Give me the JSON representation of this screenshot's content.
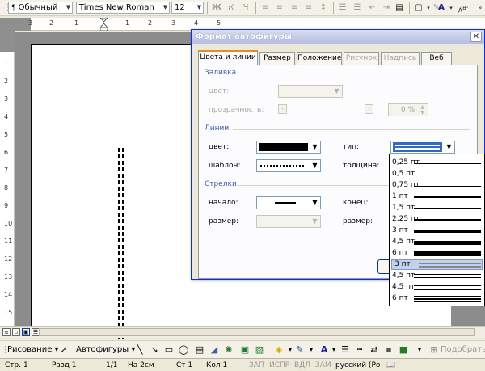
{
  "format_toolbar": {
    "style": "Обычный",
    "font": "Times New Roman",
    "size": "12"
  },
  "ruler": {
    "numbers": [
      "3",
      "2",
      "1",
      "1",
      "2",
      "3",
      "4",
      "5"
    ],
    "vnumbers": [
      "1",
      "2",
      "3",
      "4",
      "5",
      "6",
      "7",
      "8",
      "9",
      "10",
      "11",
      "12",
      "13",
      "14",
      "15"
    ]
  },
  "dialog": {
    "title": "Формат автофигуры",
    "tabs": [
      {
        "label": "Цвета и линии",
        "active": true,
        "disabled": false
      },
      {
        "label": "Размер",
        "active": false,
        "disabled": false
      },
      {
        "label": "Положение",
        "active": false,
        "disabled": false
      },
      {
        "label": "Рисунок",
        "active": false,
        "disabled": true
      },
      {
        "label": "Надпись",
        "active": false,
        "disabled": true
      },
      {
        "label": "Веб",
        "active": false,
        "disabled": false
      }
    ],
    "fill": {
      "section": "Заливка",
      "color_label": "цвет:",
      "transparency_label": "прозрачность:",
      "transparency_value": "0 %"
    },
    "lines": {
      "section": "Линии",
      "color_label": "цвет:",
      "color_value": "#000000",
      "pattern_label": "шаблон:",
      "type_label": "тип:",
      "weight_label": "толщина:"
    },
    "arrows": {
      "section": "Стрелки",
      "begin_label": "начало:",
      "end_label": "конец:",
      "begin_size_label": "размер:",
      "end_size_label": "размер:"
    }
  },
  "line_style_dropdown": [
    {
      "label": "0,25 пт",
      "style": "single"
    },
    {
      "label": "0,5 пт",
      "style": "single"
    },
    {
      "label": "0,75 пт",
      "style": "single"
    },
    {
      "label": "1 пт",
      "style": "single"
    },
    {
      "label": "1,5 пт",
      "style": "single"
    },
    {
      "label": "2,25 пт",
      "style": "single"
    },
    {
      "label": "3 пт",
      "style": "single"
    },
    {
      "label": "4,5 пт",
      "style": "single"
    },
    {
      "label": "6 пт",
      "style": "single"
    },
    {
      "label": "3 пт",
      "style": "double",
      "selected": true
    },
    {
      "label": "4,5 пт",
      "style": "double"
    },
    {
      "label": "4,5 пт",
      "style": "double"
    },
    {
      "label": "6 пт",
      "style": "triple"
    }
  ],
  "drawing_toolbar": {
    "draw_label": "Рисование",
    "autoshapes_label": "Автофигуры",
    "pick_label": "Подобрать"
  },
  "status_bar": {
    "page": "Стр. 1",
    "section": "Разд 1",
    "pages": "1/1",
    "at": "На 2см",
    "line": "Ст 1",
    "col": "Кол 1",
    "rec": "ЗАП",
    "trk": "ИСПР",
    "ext": "ВДЛ",
    "ovr": "ЗАМ",
    "lang": "русский (Ро"
  }
}
